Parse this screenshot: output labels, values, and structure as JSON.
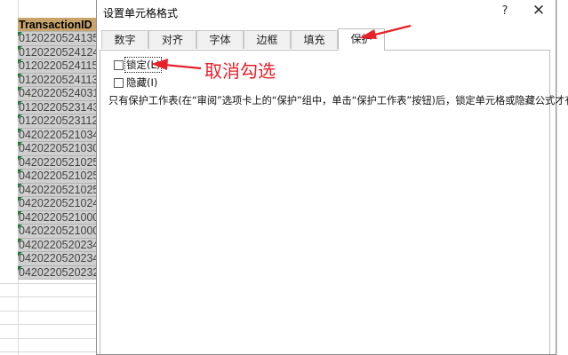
{
  "sheet": {
    "column_header": "TransactionID",
    "rows": [
      "0120220524135",
      "0120220524124",
      "0120220524115",
      "0120220524113",
      "0420220524031",
      "0120220523143",
      "0120220523112",
      "0420220521034",
      "0420220521030",
      "0420220521025",
      "0420220521025",
      "0420220521025",
      "0420220521024",
      "0420220521000",
      "0420220521000",
      "0420220520234",
      "0420220520234",
      "0420220520232"
    ]
  },
  "dialog": {
    "title": "设置单元格格式",
    "help_label": "?",
    "close_label": "✕",
    "tabs": [
      "数字",
      "对齐",
      "字体",
      "边框",
      "填充",
      "保护"
    ],
    "active_tab": "保护",
    "protection": {
      "locked_label": "锁定(L)",
      "locked_checked": false,
      "hidden_label": "隐藏(I)",
      "hidden_checked": false,
      "note": "只有保护工作表(在“审阅”选项卡上的“保护”组中，单击“保护工作表”按钮)后，锁定单元格或隐藏公式才有效。"
    }
  },
  "annotation": {
    "text": "取消勾选",
    "color": "#e8202a"
  }
}
